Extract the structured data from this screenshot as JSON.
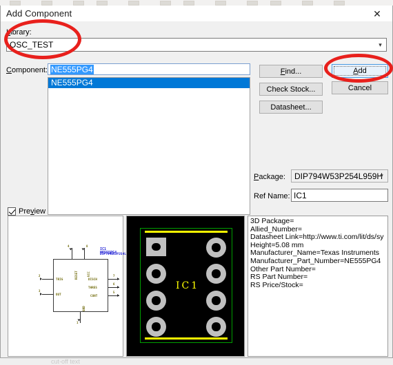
{
  "background": {
    "bottom_text": "cut-off text"
  },
  "dialog": {
    "title": "Add Component",
    "close_icon": "close-icon"
  },
  "library": {
    "label": "Library:",
    "label_mnemonic": "L",
    "value": "OSC_TEST",
    "dropdown_icon": "chevron-down-icon"
  },
  "component": {
    "label": "Component:",
    "label_mnemonic": "C",
    "value": "NE555PG4",
    "list_items": [
      {
        "label": "NE555PG4",
        "selected": true
      }
    ]
  },
  "buttons": {
    "find": "Find...",
    "find_mnemonic": "F",
    "check_stock": "Check Stock...",
    "datasheet": "Datasheet...",
    "add": "Add",
    "add_mnemonic": "A",
    "cancel": "Cancel"
  },
  "package": {
    "label": "Package:",
    "label_mnemonic": "P",
    "value": "DIP794W53P254L959H",
    "dropdown_icon": "chevron-down-icon"
  },
  "ref_name": {
    "label": "Ref Name:",
    "value": "IC1"
  },
  "preview": {
    "label": "Preview",
    "label_mnemonic": "v",
    "checked": true
  },
  "symbol_preview": {
    "pins_top": [
      {
        "name": "RESET",
        "number": "4"
      },
      {
        "name": "VCC",
        "number": "8"
      }
    ],
    "pins_left": [
      {
        "name": "TRIG",
        "number": "2"
      },
      {
        "name": "OUT",
        "number": "3"
      }
    ],
    "pins_right": [
      {
        "name": "DISCH",
        "number": "7"
      },
      {
        "name": "THRES",
        "number": "6"
      },
      {
        "name": "CONT",
        "number": "5"
      }
    ],
    "pins_bottom": [
      {
        "name": "GND",
        "number": "1"
      }
    ],
    "annotation_designator": "IC1",
    "annotation_part": "NE555PG4",
    "annotation_package": "DIP794W53P254L959H"
  },
  "footprint_preview": {
    "ref_designator": "IC1",
    "pad_count": 8,
    "outline_color": "#00a000",
    "silkscreen_color": "#ffff00",
    "pad_color": "#c0c0c0",
    "background_color": "#000000"
  },
  "info_panel": {
    "lines": [
      "3D Package=",
      "Allied_Number=",
      "Datasheet Link=http://www.ti.com/lit/ds/sy",
      "Height=5.08 mm",
      "Manufacturer_Name=Texas Instruments",
      "Manufacturer_Part_Number=NE555PG4",
      "Other Part Number=",
      "RS Part Number=",
      "RS Price/Stock="
    ]
  },
  "annotations": {
    "color": "#e8201c",
    "items": [
      {
        "name": "library-field-highlight"
      },
      {
        "name": "add-button-highlight"
      }
    ]
  }
}
